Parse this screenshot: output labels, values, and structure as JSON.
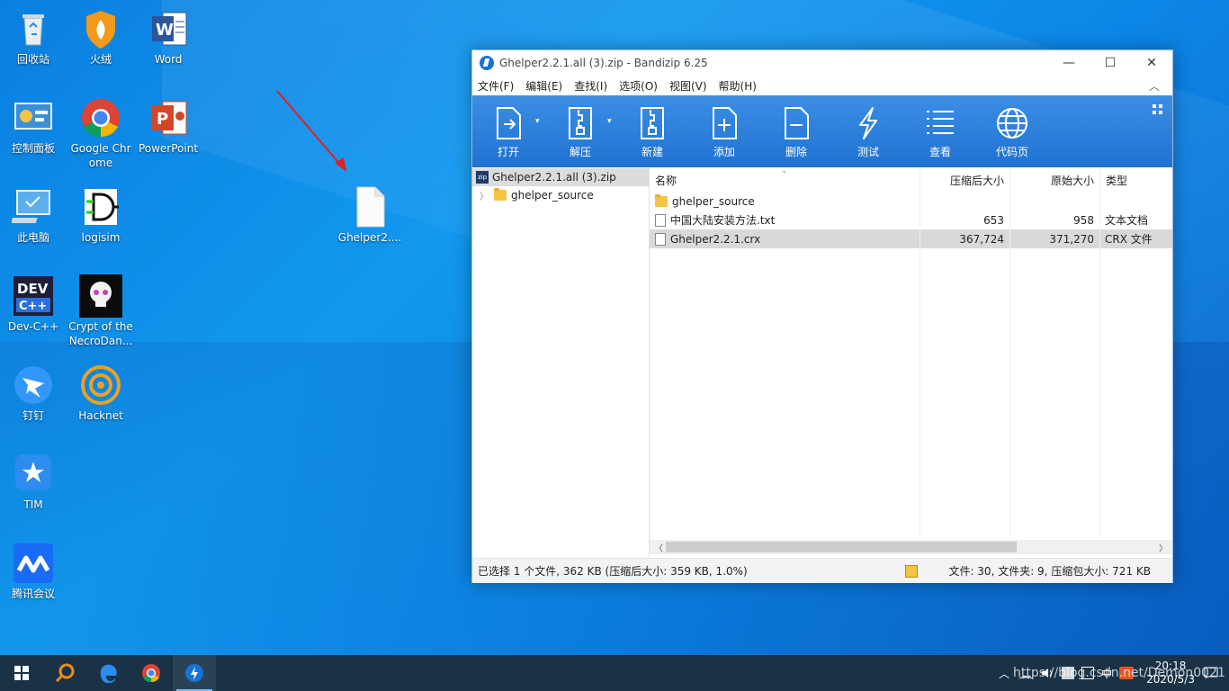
{
  "desktop": {
    "icons": [
      {
        "label": "回收站",
        "icon": "recycle-bin-icon"
      },
      {
        "label": "火绒",
        "icon": "huorong-icon"
      },
      {
        "label": "Word",
        "icon": "word-icon"
      },
      {
        "label": "控制面板",
        "icon": "control-panel-icon"
      },
      {
        "label": "Google Chrome",
        "icon": "chrome-icon"
      },
      {
        "label": "PowerPoint",
        "icon": "powerpoint-icon"
      },
      {
        "label": "此电脑",
        "icon": "this-pc-icon"
      },
      {
        "label": "logisim",
        "icon": "logisim-icon"
      },
      {
        "label": "Dev-C++",
        "icon": "devcpp-icon"
      },
      {
        "label": "Crypt of the NecroDan...",
        "icon": "crypt-necrodancer-icon"
      },
      {
        "label": "钉钉",
        "icon": "dingtalk-icon"
      },
      {
        "label": "Hacknet",
        "icon": "hacknet-icon"
      },
      {
        "label": "TIM",
        "icon": "tim-icon"
      },
      {
        "label": "腾讯会议",
        "icon": "tencent-meeting-icon"
      },
      {
        "label": "Ghelper2....",
        "icon": "file-icon"
      }
    ]
  },
  "window": {
    "title": "Ghelper2.2.1.all (3).zip - Bandizip 6.25",
    "controls": {
      "minimize": "—",
      "maximize": "☐",
      "close": "✕"
    },
    "menu": [
      "文件(F)",
      "编辑(E)",
      "查找(I)",
      "选项(O)",
      "视图(V)",
      "帮助(H)"
    ],
    "toolbar": [
      {
        "label": "打开",
        "icon": "open-icon"
      },
      {
        "label": "解压",
        "icon": "extract-icon"
      },
      {
        "label": "新建",
        "icon": "new-archive-icon"
      },
      {
        "label": "添加",
        "icon": "add-file-icon"
      },
      {
        "label": "删除",
        "icon": "delete-file-icon"
      },
      {
        "label": "测试",
        "icon": "test-bolt-icon"
      },
      {
        "label": "查看",
        "icon": "view-list-icon"
      },
      {
        "label": "代码页",
        "icon": "codepage-globe-icon"
      }
    ],
    "tree": {
      "root": "Ghelper2.2.1.all (3).zip",
      "children": [
        "ghelper_source"
      ]
    },
    "columns": {
      "name": "名称",
      "compressed": "压缩后大小",
      "original": "原始大小",
      "type": "类型"
    },
    "files": [
      {
        "name": "ghelper_source",
        "compressed": "",
        "original": "",
        "type": "",
        "kind": "folder"
      },
      {
        "name": "中国大陆安装方法.txt",
        "compressed": "653",
        "original": "958",
        "type": "文本文档",
        "kind": "file"
      },
      {
        "name": "Ghelper2.2.1.crx",
        "compressed": "367,724",
        "original": "371,270",
        "type": "CRX 文件",
        "kind": "file"
      }
    ],
    "status": {
      "left": "已选择 1 个文件, 362 KB (压缩后大小: 359 KB, 1.0%)",
      "right": "文件: 30, 文件夹: 9, 压缩包大小: 721 KB"
    }
  },
  "taskbar": {
    "time": "20:18",
    "date": "2020/5/3",
    "ime": "中",
    "watermark": "https://blog.csdn.net/Demon0021"
  }
}
